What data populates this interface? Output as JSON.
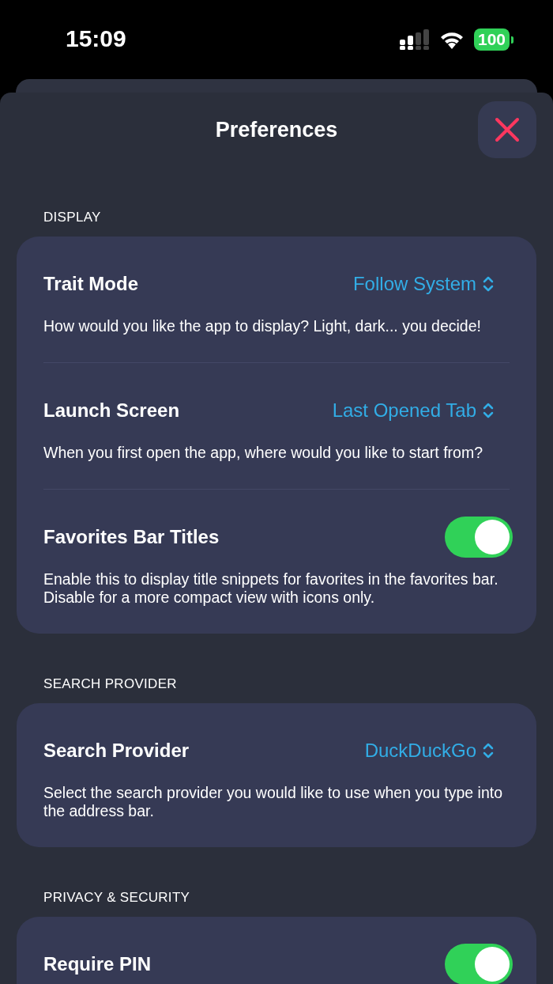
{
  "status_bar": {
    "time": "15:09",
    "battery": "100"
  },
  "title": "Preferences",
  "sections": [
    {
      "header": "DISPLAY",
      "rows": [
        {
          "kind": "picker",
          "title": "Trait Mode",
          "value": "Follow System",
          "description": "How would you like the app to display? Light, dark... you decide!"
        },
        {
          "kind": "picker",
          "title": "Launch Screen",
          "value": "Last Opened Tab",
          "description": "When you first open the app, where would you like to start from?"
        },
        {
          "kind": "toggle",
          "title": "Favorites Bar Titles",
          "on": true,
          "description": "Enable this to display title snippets for favorites in the favorites bar. Disable for a more compact view with icons only."
        }
      ]
    },
    {
      "header": "SEARCH PROVIDER",
      "rows": [
        {
          "kind": "picker",
          "title": "Search Provider",
          "value": "DuckDuckGo",
          "description": "Select the search provider you would like to use when you type into the address bar."
        }
      ]
    },
    {
      "header": "PRIVACY & SECURITY",
      "rows": [
        {
          "kind": "toggle",
          "title": "Require PIN",
          "on": true
        }
      ]
    }
  ]
}
